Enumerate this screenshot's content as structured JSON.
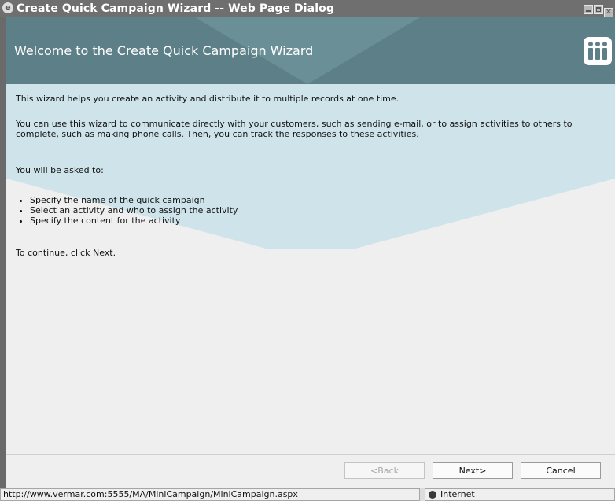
{
  "window": {
    "title": "Create Quick Campaign Wizard -- Web Page Dialog"
  },
  "header": {
    "heading": "Welcome to the Create Quick Campaign Wizard"
  },
  "body": {
    "intro": "This wizard helps you create an activity and distribute it to multiple records at one time.",
    "description": "You can use this wizard to communicate directly with your customers, such as sending e-mail, or to assign activities to others to complete, such as making phone calls. Then, you can track the responses to these activities.",
    "asked": "You will be asked to:",
    "steps": [
      "Specify the name of the quick campaign",
      "Select an activity and who to assign the activity",
      "Specify the content for the activity"
    ],
    "continue": "To continue, click Next."
  },
  "buttons": {
    "back": "<Back",
    "next": "Next>",
    "cancel": "Cancel"
  },
  "status": {
    "url": "http://www.vermar.com:5555/MA/MiniCampaign/MiniCampaign.aspx",
    "zone": "Internet"
  }
}
